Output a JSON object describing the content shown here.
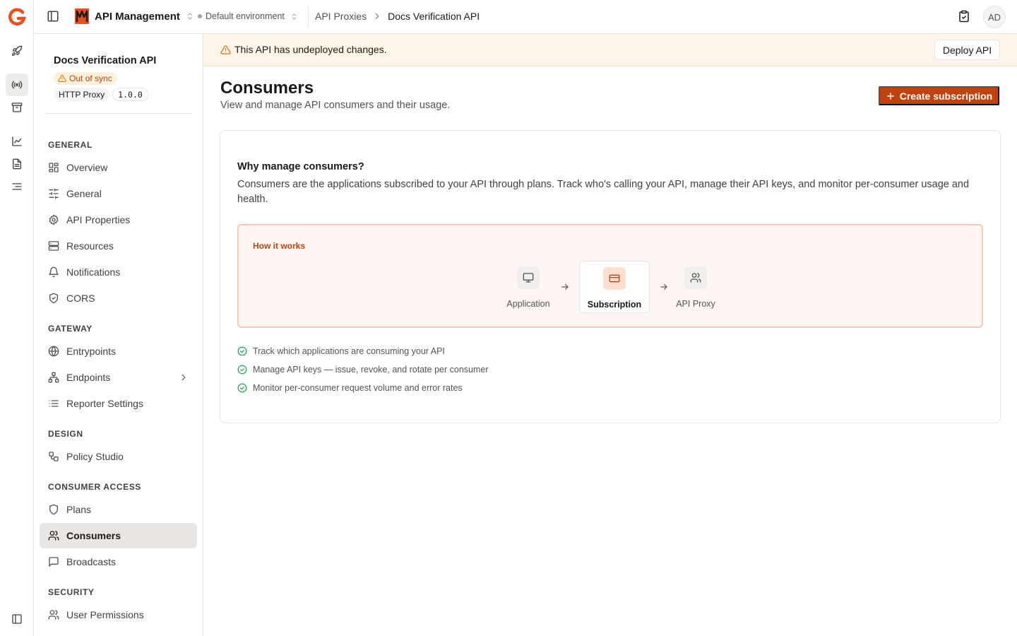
{
  "topbar": {
    "app_name": "API Management",
    "environment": "Default environment",
    "breadcrumb": [
      "API Proxies",
      "Docs Verification API"
    ],
    "avatar_initials": "AD"
  },
  "api": {
    "name": "Docs Verification API",
    "sync_status": "Out of sync",
    "type": "HTTP Proxy",
    "version": "1.0.0"
  },
  "sidebar": {
    "sections": [
      {
        "title": "GENERAL",
        "items": [
          "Overview",
          "General",
          "API Properties",
          "Resources",
          "Notifications",
          "CORS"
        ]
      },
      {
        "title": "GATEWAY",
        "items": [
          "Entrypoints",
          "Endpoints",
          "Reporter Settings"
        ]
      },
      {
        "title": "DESIGN",
        "items": [
          "Policy Studio"
        ]
      },
      {
        "title": "CONSUMER ACCESS",
        "items": [
          "Plans",
          "Consumers",
          "Broadcasts"
        ]
      },
      {
        "title": "SECURITY",
        "items": [
          "User Permissions"
        ]
      }
    ],
    "active_item": "Consumers"
  },
  "banner": {
    "message": "This API has undeployed changes.",
    "deploy_label": "Deploy API"
  },
  "page": {
    "title": "Consumers",
    "subtitle": "View and manage API consumers and their usage.",
    "create_label": "Create subscription"
  },
  "card": {
    "why_title": "Why manage consumers?",
    "why_desc": "Consumers are the applications subscribed to your API through plans. Track who's calling your API, manage their API keys, and monitor per-consumer usage and health.",
    "how_title": "How it works",
    "flow": [
      "Application",
      "Subscription",
      "API Proxy"
    ],
    "bullets": [
      "Track which applications are consuming your API",
      "Manage API keys — issue, revoke, and rotate per consumer",
      "Monitor per-consumer request volume and error rates"
    ]
  },
  "colors": {
    "accent": "#c2410c",
    "warning_bg": "#fdf5e9",
    "success": "#16a34a"
  }
}
